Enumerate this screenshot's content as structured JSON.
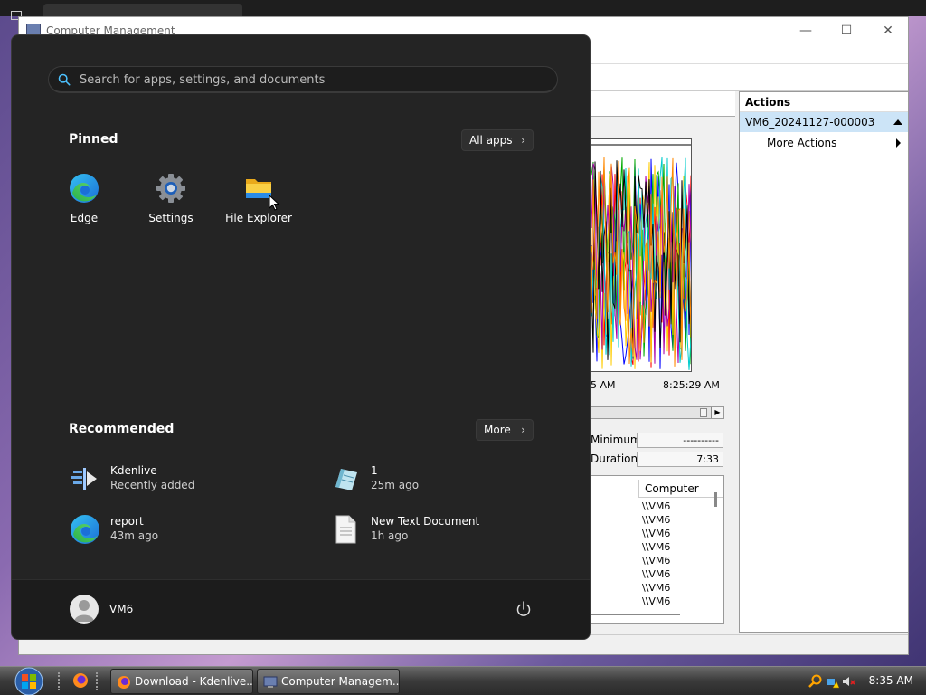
{
  "cm_window": {
    "title": "Computer Management",
    "graph_time_left": "5 AM",
    "graph_time_right": "8:25:29 AM",
    "stat_minimum_label": "Minimum",
    "stat_minimum_value": "----------",
    "stat_duration_label": "Duration",
    "stat_duration_value": "7:33",
    "table_header": "Computer",
    "table_rows": [
      "\\\\VM6",
      "\\\\VM6",
      "\\\\VM6",
      "\\\\VM6",
      "\\\\VM6",
      "\\\\VM6",
      "\\\\VM6",
      "\\\\VM6"
    ],
    "actions": {
      "title": "Actions",
      "item": "VM6_20241127-000003",
      "more": "More Actions"
    }
  },
  "start_menu": {
    "search_placeholder": "Search for apps, settings, and documents",
    "pinned_title": "Pinned",
    "all_apps_label": "All apps",
    "pinned_apps": [
      {
        "label": "Edge",
        "icon": "edge-icon"
      },
      {
        "label": "Settings",
        "icon": "gear-icon"
      },
      {
        "label": "File Explorer",
        "icon": "folder-icon"
      }
    ],
    "recommended_title": "Recommended",
    "more_label": "More",
    "recommended": [
      {
        "name": "Kdenlive",
        "sub": "Recently added",
        "icon": "kdenlive-icon"
      },
      {
        "name": "1",
        "sub": "25m ago",
        "icon": "notepad-icon"
      },
      {
        "name": "report",
        "sub": "43m ago",
        "icon": "edge-icon"
      },
      {
        "name": "New Text Document",
        "sub": "1h ago",
        "icon": "text-document-icon"
      }
    ],
    "user_name": "VM6"
  },
  "taskbar": {
    "buttons": [
      {
        "label": "Download - Kdenlive..."
      },
      {
        "label": "Computer Managem..."
      }
    ],
    "clock": "8:35 AM"
  },
  "colors": {
    "start_bg": "#242424",
    "accent_blue": "#0078d4",
    "actions_selected": "#cce4f7"
  }
}
